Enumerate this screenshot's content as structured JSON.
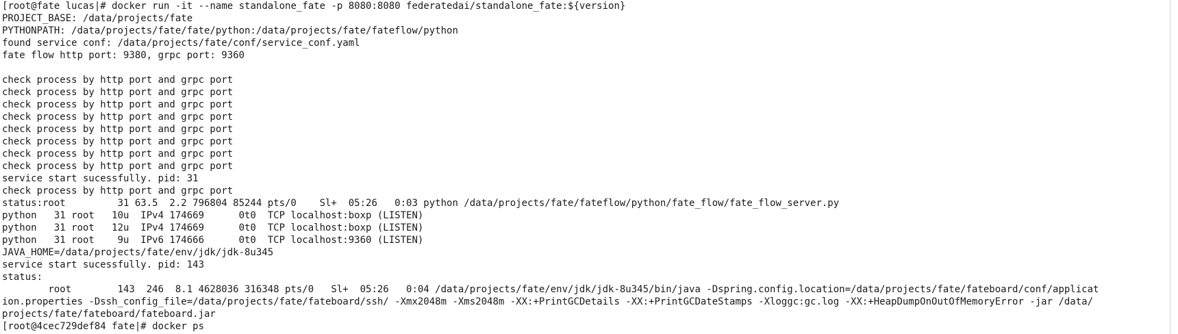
{
  "terminal": {
    "lines": [
      {
        "kind": "prompt",
        "prompt": "root@fate lucas",
        "command": "docker run -it --name standalone_fate -p 8080:8080 federatedai/standalone_fate:${version}"
      },
      {
        "kind": "output",
        "text": "PROJECT_BASE: /data/projects/fate"
      },
      {
        "kind": "output",
        "text": "PYTHONPATH: /data/projects/fate/fate/python:/data/projects/fate/fateflow/python"
      },
      {
        "kind": "output",
        "text": "found service conf: /data/projects/fate/conf/service_conf.yaml"
      },
      {
        "kind": "output",
        "text": "fate flow http port: 9380, grpc port: 9360"
      },
      {
        "kind": "output",
        "text": ""
      },
      {
        "kind": "output",
        "text": "check process by http port and grpc port"
      },
      {
        "kind": "output",
        "text": "check process by http port and grpc port"
      },
      {
        "kind": "output",
        "text": "check process by http port and grpc port"
      },
      {
        "kind": "output",
        "text": "check process by http port and grpc port"
      },
      {
        "kind": "output",
        "text": "check process by http port and grpc port"
      },
      {
        "kind": "output",
        "text": "check process by http port and grpc port"
      },
      {
        "kind": "output",
        "text": "check process by http port and grpc port"
      },
      {
        "kind": "output",
        "text": "check process by http port and grpc port"
      },
      {
        "kind": "output",
        "text": "service start sucessfully. pid: 31"
      },
      {
        "kind": "output",
        "text": "check process by http port and grpc port"
      },
      {
        "kind": "output",
        "text": "status:root         31 63.5  2.2 796804 85244 pts/0    Sl+  05:26   0:03 python /data/projects/fate/fateflow/python/fate_flow/fate_flow_server.py"
      },
      {
        "kind": "output",
        "text": "python   31 root   10u  IPv4 174669      0t0  TCP localhost:boxp (LISTEN)"
      },
      {
        "kind": "output",
        "text": "python   31 root   12u  IPv4 174669      0t0  TCP localhost:boxp (LISTEN)"
      },
      {
        "kind": "output",
        "text": "python   31 root    9u  IPv6 174666      0t0  TCP localhost:9360 (LISTEN)"
      },
      {
        "kind": "output",
        "text": "JAVA_HOME=/data/projects/fate/env/jdk/jdk-8u345"
      },
      {
        "kind": "output",
        "text": "service start sucessfully. pid: 143"
      },
      {
        "kind": "output",
        "text": "status:"
      },
      {
        "kind": "output",
        "text": "        root        143  246  8.1 4628036 316348 pts/0   Sl+  05:26   0:04 /data/projects/fate/env/jdk/jdk-8u345/bin/java -Dspring.config.location=/data/projects/fate/fateboard/conf/applicat"
      },
      {
        "kind": "output",
        "text": "ion.properties -Dssh_config_file=/data/projects/fate/fateboard/ssh/ -Xmx2048m -Xms2048m -XX:+PrintGCDetails -XX:+PrintGCDateStamps -Xloggc:gc.log -XX:+HeapDumpOnOutOfMemoryError -jar /data/"
      },
      {
        "kind": "output",
        "text": "projects/fate/fateboard/fateboard.jar"
      },
      {
        "kind": "prompt",
        "prompt": "root@4cec729def84 fate",
        "command": "docker ps"
      }
    ]
  }
}
